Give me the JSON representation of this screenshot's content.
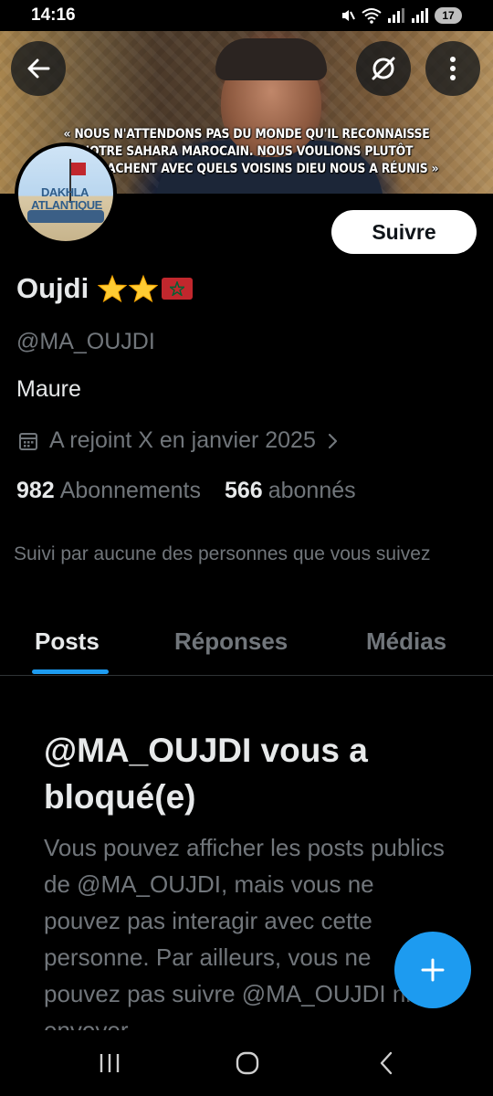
{
  "status_bar": {
    "time": "14:16",
    "battery": "17"
  },
  "banner": {
    "quote_lines": [
      "« NOUS N'ATTENDONS PAS DU MONDE QU'IL RECONNAISSE",
      "NOTRE SAHARA MAROCAIN. NOUS VOULIONS PLUTÔT",
      "QU'ILS SACHENT AVEC QUELS VOISINS DIEU NOUS A RÉUNIS »"
    ]
  },
  "avatar": {
    "sign_text": "DAKHLA ATLANTIQUE"
  },
  "profile": {
    "follow_label": "Suivre",
    "display_name": "Oujdi",
    "handle": "@MA_OUJDI",
    "bio": "Maure",
    "joined": "A rejoint X en janvier 2025",
    "following_count": "982",
    "following_label": "Abonnements",
    "followers_count": "566",
    "followers_label": "abonnés",
    "followed_by": "Suivi par aucune des personnes que vous suivez"
  },
  "tabs": [
    {
      "label": "Posts",
      "active": true
    },
    {
      "label": "Réponses",
      "active": false
    },
    {
      "label": "Médias",
      "active": false
    }
  ],
  "blocked": {
    "title": "@MA_OUJDI vous a bloqué(e)",
    "body": "Vous pouvez afficher les posts publics de @MA_OUJDI, mais vous ne pouvez pas interagir avec cette personne. Par ailleurs, vous ne pouvez pas suivre @MA_OUJDI ni lui envoyer"
  },
  "colors": {
    "accent": "#1d9bf0",
    "muted": "#71767b",
    "text": "#e7e9ea",
    "background": "#000000"
  }
}
